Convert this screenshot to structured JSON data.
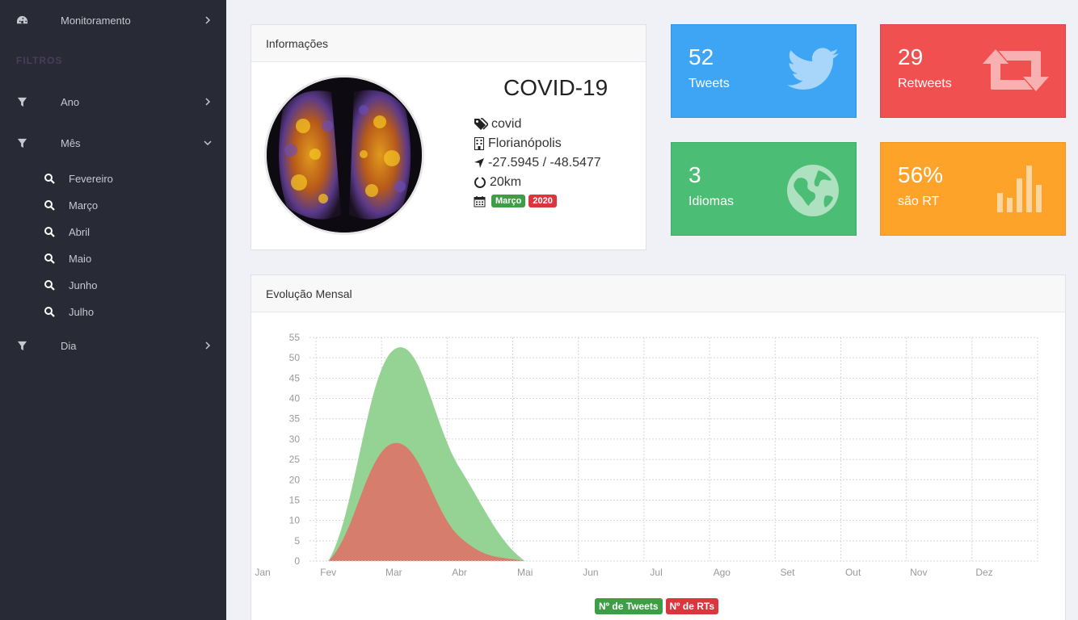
{
  "sidebar": {
    "monitoramento": "Monitoramento",
    "filtros": "FILTROS",
    "ano": "Ano",
    "mes": "Mês",
    "meses": [
      "Fevereiro",
      "Março",
      "Abril",
      "Maio",
      "Junho",
      "Julho"
    ],
    "dia": "Dia"
  },
  "info": {
    "header": "Informações",
    "title": "COVID-19",
    "tag": "covid",
    "city": "Florianópolis",
    "coords": "-27.5945 / -48.5477",
    "radius": "20km",
    "badge_month": "Março",
    "badge_year": "2020"
  },
  "tiles": {
    "tweets": {
      "value": "52",
      "label": "Tweets",
      "color": "#3da5f4",
      "icon": "twitter-icon"
    },
    "retweets": {
      "value": "29",
      "label": "Retweets",
      "color": "#f05050",
      "icon": "retweet-icon"
    },
    "idiomas": {
      "value": "3",
      "label": "Idiomas",
      "color": "#4cbd74",
      "icon": "globe-icon"
    },
    "rt": {
      "value": "56%",
      "label": "são RT",
      "color": "#fda32a",
      "icon": "bar-chart-icon"
    }
  },
  "chart_card": {
    "header": "Evolução Mensal"
  },
  "chart_data": {
    "type": "area",
    "categories": [
      "Jan",
      "Fev",
      "Mar",
      "Abr",
      "Mai",
      "Jun",
      "Jul",
      "Ago",
      "Set",
      "Out",
      "Nov",
      "Dez"
    ],
    "yticks": [
      "0",
      "5",
      "10",
      "15",
      "20",
      "25",
      "30",
      "35",
      "40",
      "45",
      "50",
      "55"
    ],
    "ylim": [
      0,
      55
    ],
    "grid": true,
    "legend_position": "bottom",
    "series": [
      {
        "name": "Nº de Tweets",
        "color": "#4cbd74",
        "fill": "#8fd18e",
        "values": [
          0,
          0,
          52,
          23,
          0,
          0,
          0,
          0,
          0,
          0,
          0,
          0
        ]
      },
      {
        "name": "Nº de RTs",
        "color": "#d9534f",
        "fill": "#d9786a",
        "values": [
          0,
          0,
          29,
          6,
          0,
          0,
          0,
          0,
          0,
          0,
          0,
          0
        ]
      }
    ]
  }
}
